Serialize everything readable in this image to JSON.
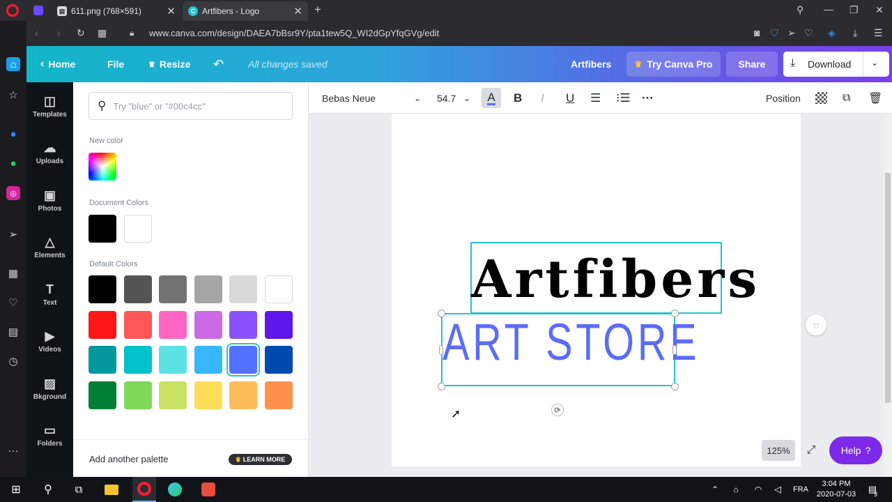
{
  "browser": {
    "tabs": [
      {
        "title": "611.png (768×591)"
      },
      {
        "title": "Artfibers - Logo"
      }
    ],
    "url": "www.canva.com/design/DAEA7bBsr9Y/pta1tew5Q_WI2dGpYfqGVg/edit"
  },
  "header": {
    "home": "Home",
    "file": "File",
    "resize": "Resize",
    "saved": "All changes saved",
    "design_name": "Artfibers",
    "try_pro": "Try Canva Pro",
    "share": "Share",
    "download": "Download"
  },
  "leftnav": {
    "items": [
      {
        "label": "Templates",
        "icon": "templates-icon"
      },
      {
        "label": "Uploads",
        "icon": "upload-icon"
      },
      {
        "label": "Photos",
        "icon": "photos-icon"
      },
      {
        "label": "Elements",
        "icon": "elements-icon"
      },
      {
        "label": "Text",
        "icon": "text-icon"
      },
      {
        "label": "Videos",
        "icon": "videos-icon"
      },
      {
        "label": "Bkground",
        "icon": "background-icon"
      },
      {
        "label": "Folders",
        "icon": "folder-icon"
      }
    ]
  },
  "panel": {
    "search_placeholder": "Try \"blue\" or \"#00c4cc\"",
    "new_color_label": "New color",
    "document_colors_label": "Document Colors",
    "document_colors": [
      "#000000",
      "#ffffff"
    ],
    "default_colors_label": "Default Colors",
    "default_colors": [
      "#000000",
      "#545454",
      "#737373",
      "#a6a6a6",
      "#d9d9d9",
      "#ffffff",
      "#ff1616",
      "#ff5757",
      "#ff66c4",
      "#cb6ce6",
      "#8c52ff",
      "#5e17eb",
      "#03989e",
      "#00c2cb",
      "#5ce1e6",
      "#38b6ff",
      "#5271ff",
      "#004aad",
      "#008037",
      "#7ed957",
      "#c9e265",
      "#ffde59",
      "#ffbd59",
      "#ff914d"
    ],
    "selected_color": "#5271ff",
    "add_palette": "Add another palette",
    "learn_more": "LEARN MORE"
  },
  "toolbar": {
    "font": "Bebas Neue",
    "size": "54.7",
    "position": "Position"
  },
  "canvas": {
    "title_text": "Artfibers",
    "subtitle_text": "ART STORE",
    "zoom": "125%",
    "help": "Help",
    "help_icon": "?"
  },
  "taskbar": {
    "language": "FRA",
    "time": "3:04 PM",
    "date": "2020-07-03",
    "notifications": "9"
  },
  "colors": {
    "accent": "#7d2ae8",
    "selection": "#26c2ce",
    "text_color": "#5b6cf5"
  }
}
